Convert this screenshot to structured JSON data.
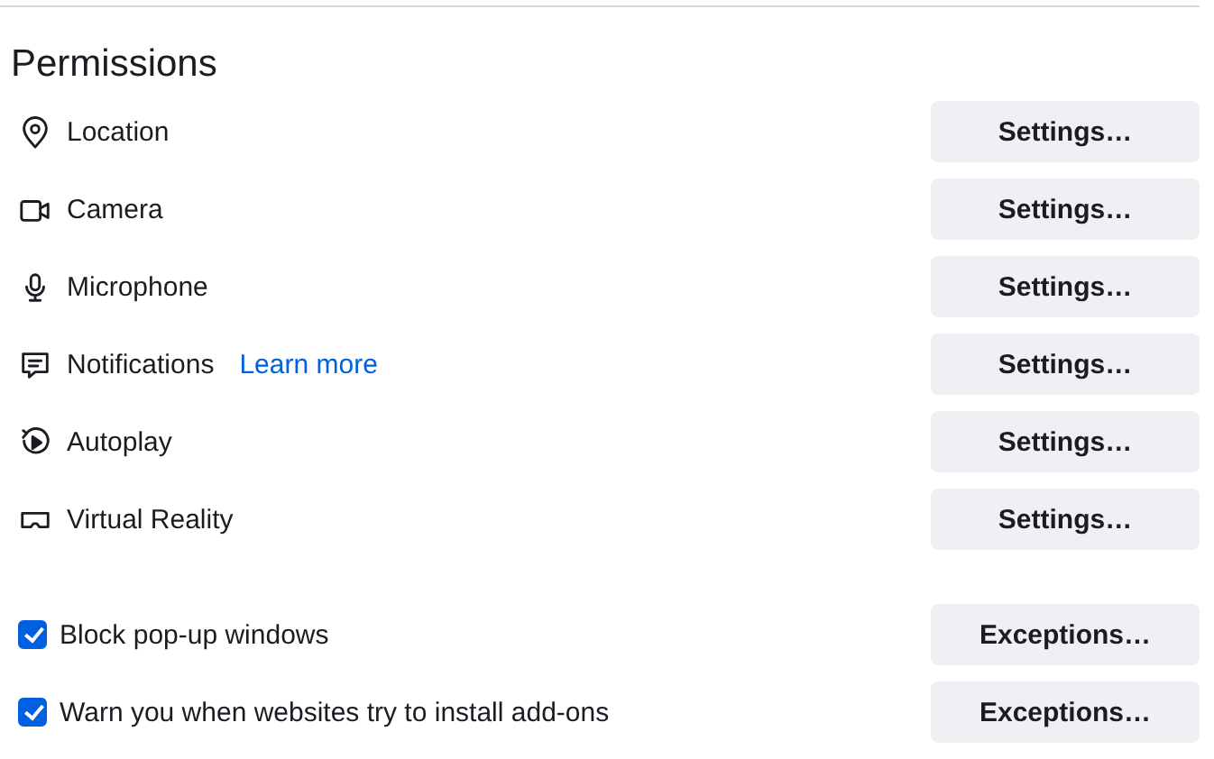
{
  "title": "Permissions",
  "permissions": [
    {
      "kind": "location",
      "label": "Location",
      "button": "Settings…"
    },
    {
      "kind": "camera",
      "label": "Camera",
      "button": "Settings…"
    },
    {
      "kind": "microphone",
      "label": "Microphone",
      "button": "Settings…"
    },
    {
      "kind": "notifications",
      "label": "Notifications",
      "link": "Learn more",
      "button": "Settings…"
    },
    {
      "kind": "autoplay",
      "label": "Autoplay",
      "button": "Settings…"
    },
    {
      "kind": "vr",
      "label": "Virtual Reality",
      "button": "Settings…"
    }
  ],
  "options": [
    {
      "label": "Block pop-up windows",
      "checked": true,
      "button": "Exceptions…"
    },
    {
      "label": "Warn you when websites try to install add-ons",
      "checked": true,
      "button": "Exceptions…"
    }
  ]
}
